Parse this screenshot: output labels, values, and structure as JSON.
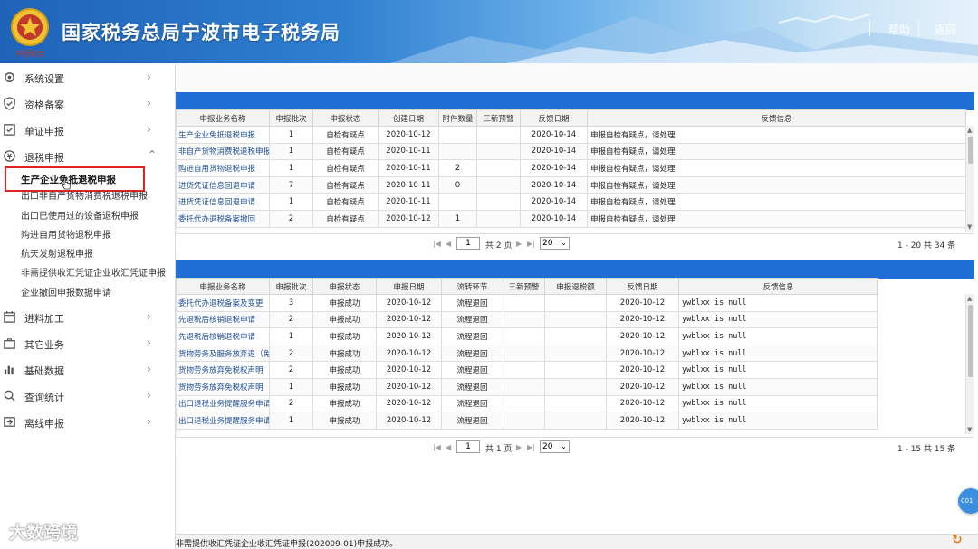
{
  "header": {
    "title": "国家税务总局宁波市电子税务局",
    "emblem_caption": "中国税务",
    "help_label": "帮助",
    "back_label": "返回"
  },
  "colors": {
    "accent_blue": "#1e6ed6",
    "highlight_red": "#e02424",
    "header_blue": "#2f7fd0"
  },
  "sidebar": {
    "items": [
      {
        "label": "系统设置",
        "icon": "gear-icon"
      },
      {
        "label": "资格备案",
        "icon": "shield-icon"
      },
      {
        "label": "单证申报",
        "icon": "checkbox-icon"
      },
      {
        "label": "退税申报",
        "icon": "refund-icon"
      },
      {
        "label": "进料加工",
        "icon": "calendar-icon"
      },
      {
        "label": "其它业务",
        "icon": "briefcase-icon"
      },
      {
        "label": "基础数据",
        "icon": "bar-chart-icon"
      },
      {
        "label": "查询统计",
        "icon": "search-icon"
      },
      {
        "label": "离线申报",
        "icon": "offline-icon"
      }
    ],
    "submenu": [
      "生产企业免抵退税申报",
      "出口非自产货物消费税退税申报",
      "出口已使用过的设备退税申报",
      "购进自用货物退税申报",
      "航天发射退税申报",
      "非需提供收汇凭证企业收汇凭证申报",
      "企业撤回申报数据申请"
    ]
  },
  "table1": {
    "columns": [
      "申报业务名称",
      "申报批次",
      "申报状态",
      "创建日期",
      "附件数量",
      "三新预警",
      "反馈日期",
      "反馈信息"
    ],
    "rows": [
      [
        "生产企业免抵退税申报",
        "1",
        "自检有疑点",
        "2020-10-12",
        "",
        "",
        "2020-10-14",
        "申报自检有疑点，请处理"
      ],
      [
        "非自产货物消费税退税申报",
        "1",
        "自检有疑点",
        "2020-10-11",
        "",
        "",
        "2020-10-14",
        "申报自检有疑点，请处理"
      ],
      [
        "购进自用货物退税申报",
        "1",
        "自检有疑点",
        "2020-10-11",
        "2",
        "",
        "2020-10-14",
        "申报自检有疑点，请处理"
      ],
      [
        "进货凭证信息回退申请",
        "7",
        "自检有疑点",
        "2020-10-11",
        "0",
        "",
        "2020-10-14",
        "申报自检有疑点，请处理"
      ],
      [
        "进货凭证信息回退申请",
        "1",
        "自检有疑点",
        "2020-10-11",
        "",
        "",
        "2020-10-14",
        "申报自检有疑点，请处理"
      ],
      [
        "委托代办退税备案撤回",
        "2",
        "自检有疑点",
        "2020-10-12",
        "1",
        "",
        "2020-10-14",
        "申报自检有疑点，请处理"
      ]
    ],
    "pager": {
      "page": "1",
      "of_label": "共 2 页",
      "page_size": "20",
      "summary": "1 - 20  共 34 条"
    }
  },
  "table2": {
    "columns": [
      "申报业务名称",
      "申报批次",
      "申报状态",
      "申报日期",
      "流转环节",
      "三新预警",
      "申报退税额",
      "反馈日期",
      "反馈信息"
    ],
    "rows": [
      [
        "委托代办退税备案及变更",
        "3",
        "申报成功",
        "2020-10-12",
        "流程退回",
        "",
        "",
        "2020-10-12",
        "ywblxx is null"
      ],
      [
        "先退税后核销退税申请",
        "2",
        "申报成功",
        "2020-10-12",
        "流程退回",
        "",
        "",
        "2020-10-12",
        "ywblxx is null"
      ],
      [
        "先退税后核销退税申请",
        "1",
        "申报成功",
        "2020-10-12",
        "流程退回",
        "",
        "",
        "2020-10-12",
        "ywblxx is null"
      ],
      [
        "货物劳务及服务放弃退（免）税",
        "2",
        "申报成功",
        "2020-10-12",
        "流程退回",
        "",
        "",
        "2020-10-12",
        "ywblxx is null"
      ],
      [
        "货物劳务放弃免税权声明",
        "2",
        "申报成功",
        "2020-10-12",
        "流程退回",
        "",
        "",
        "2020-10-12",
        "ywblxx is null"
      ],
      [
        "货物劳务放弃免税权声明",
        "1",
        "申报成功",
        "2020-10-12",
        "流程退回",
        "",
        "",
        "2020-10-12",
        "ywblxx is null"
      ],
      [
        "出口退税业务提醒服务申请",
        "2",
        "申报成功",
        "2020-10-12",
        "流程退回",
        "",
        "",
        "2020-10-12",
        "ywblxx is null"
      ],
      [
        "出口退税业务提醒服务申请",
        "1",
        "申报成功",
        "2020-10-12",
        "流程退回",
        "",
        "",
        "2020-10-12",
        "ywblxx is null"
      ]
    ],
    "pager": {
      "page": "1",
      "of_label": "共 1 页",
      "page_size": "20",
      "summary": "1 - 15  共 15 条"
    }
  },
  "status_message": "非需提供收汇凭证企业收汇凭证申报(202009-01)申报成功。",
  "watermark": "大数跨境"
}
